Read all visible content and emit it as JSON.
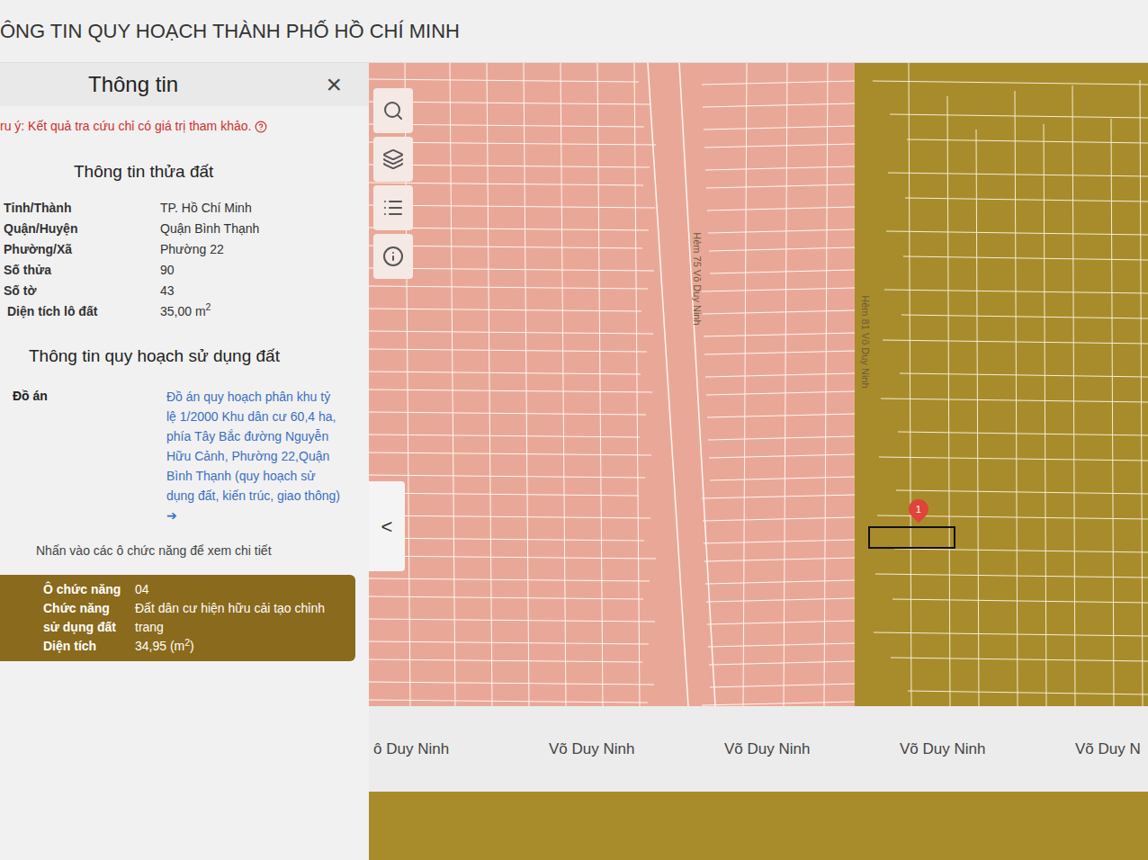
{
  "header": {
    "title": "ÔNG TIN QUY HOẠCH THÀNH PHỐ HỒ CHÍ MINH"
  },
  "panel": {
    "title": "Thông tin",
    "close": "×",
    "note": "ru ý: Kết quả tra cứu chỉ có giá trị tham khảo.",
    "parcel_heading": "Thông tin thửa đất",
    "parcel_rows": [
      {
        "label": "Tỉnh/Thành",
        "value": "TP. Hồ Chí Minh"
      },
      {
        "label": "Quận/Huyện",
        "value": "Quận Bình Thạnh"
      },
      {
        "label": "Phường/Xã",
        "value": "Phường 22"
      },
      {
        "label": "Số thửa",
        "value": "90"
      },
      {
        "label": "Số tờ",
        "value": "43"
      }
    ],
    "area": {
      "label": "Diện tích lô đất",
      "value": "35,00 m",
      "sup": "2"
    },
    "plan_heading": "Thông tin quy hoạch sử dụng đất",
    "plan": {
      "label": "Đồ án",
      "link": "Đồ án quy hoạch phân khu tỷ lệ 1/2000 Khu dân cư 60,4 ha, phía Tây Bắc đường Nguyễn Hữu Cảnh, Phường 22,Quận Bình Thạnh (quy hoạch sử dụng đất, kiến trúc, giao thông)",
      "arrow": "➔"
    },
    "hint": "Nhấn vào các ô chức năng để xem chi tiết",
    "function_box": {
      "color": "#8a6a1c",
      "rows": [
        {
          "label": "Ô chức năng",
          "value": "04",
          "sup": "",
          "after": ""
        },
        {
          "label": "Chức năng sử dụng đất",
          "value": "Đất dân cư hiện hữu cải tạo chỉnh trang",
          "sup": "",
          "after": ""
        },
        {
          "label": "Diện tích",
          "value": "34,95 (m",
          "sup": "2",
          "after": ")"
        }
      ]
    }
  },
  "map": {
    "zones": [
      {
        "name": "residential-pink",
        "color": "#e9a897"
      },
      {
        "name": "residential-olive",
        "color": "#a88c2c"
      }
    ],
    "road_labels": [
      "ô Duy Ninh",
      "Võ Duy Ninh",
      "Võ Duy Ninh",
      "Võ Duy Ninh",
      "Võ Duy N"
    ],
    "alley_labels": [
      "Hẻm 75 Võ Duy Ninh",
      "Hẻm 81 Võ Duy Ninh"
    ],
    "pin": {
      "label": "1"
    },
    "collapse": "<"
  }
}
